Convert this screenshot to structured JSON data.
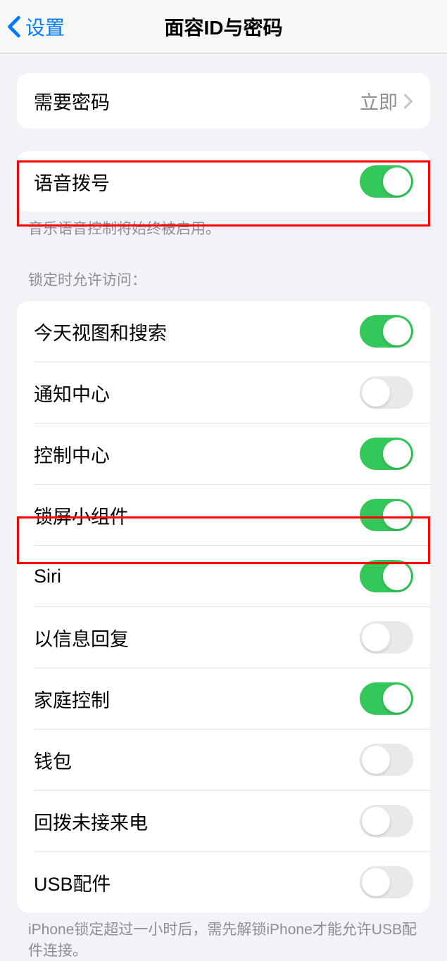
{
  "header": {
    "back_label": "设置",
    "title": "面容ID与密码"
  },
  "require_passcode": {
    "label": "需要密码",
    "value": "立即"
  },
  "voice_dial": {
    "label": "语音拨号",
    "enabled": true,
    "footer": "音乐语音控制将始终被启用。"
  },
  "access_section": {
    "header": "锁定时允许访问：",
    "items": [
      {
        "label": "今天视图和搜索",
        "enabled": true
      },
      {
        "label": "通知中心",
        "enabled": false
      },
      {
        "label": "控制中心",
        "enabled": true
      },
      {
        "label": "锁屏小组件",
        "enabled": true
      },
      {
        "label": "Siri",
        "enabled": true
      },
      {
        "label": "以信息回复",
        "enabled": false
      },
      {
        "label": "家庭控制",
        "enabled": true
      },
      {
        "label": "钱包",
        "enabled": false
      },
      {
        "label": "回拨未接来电",
        "enabled": false
      },
      {
        "label": "USB配件",
        "enabled": false
      }
    ],
    "footer": "iPhone锁定超过一小时后，需先解锁iPhone才能允许USB配件连接。"
  }
}
